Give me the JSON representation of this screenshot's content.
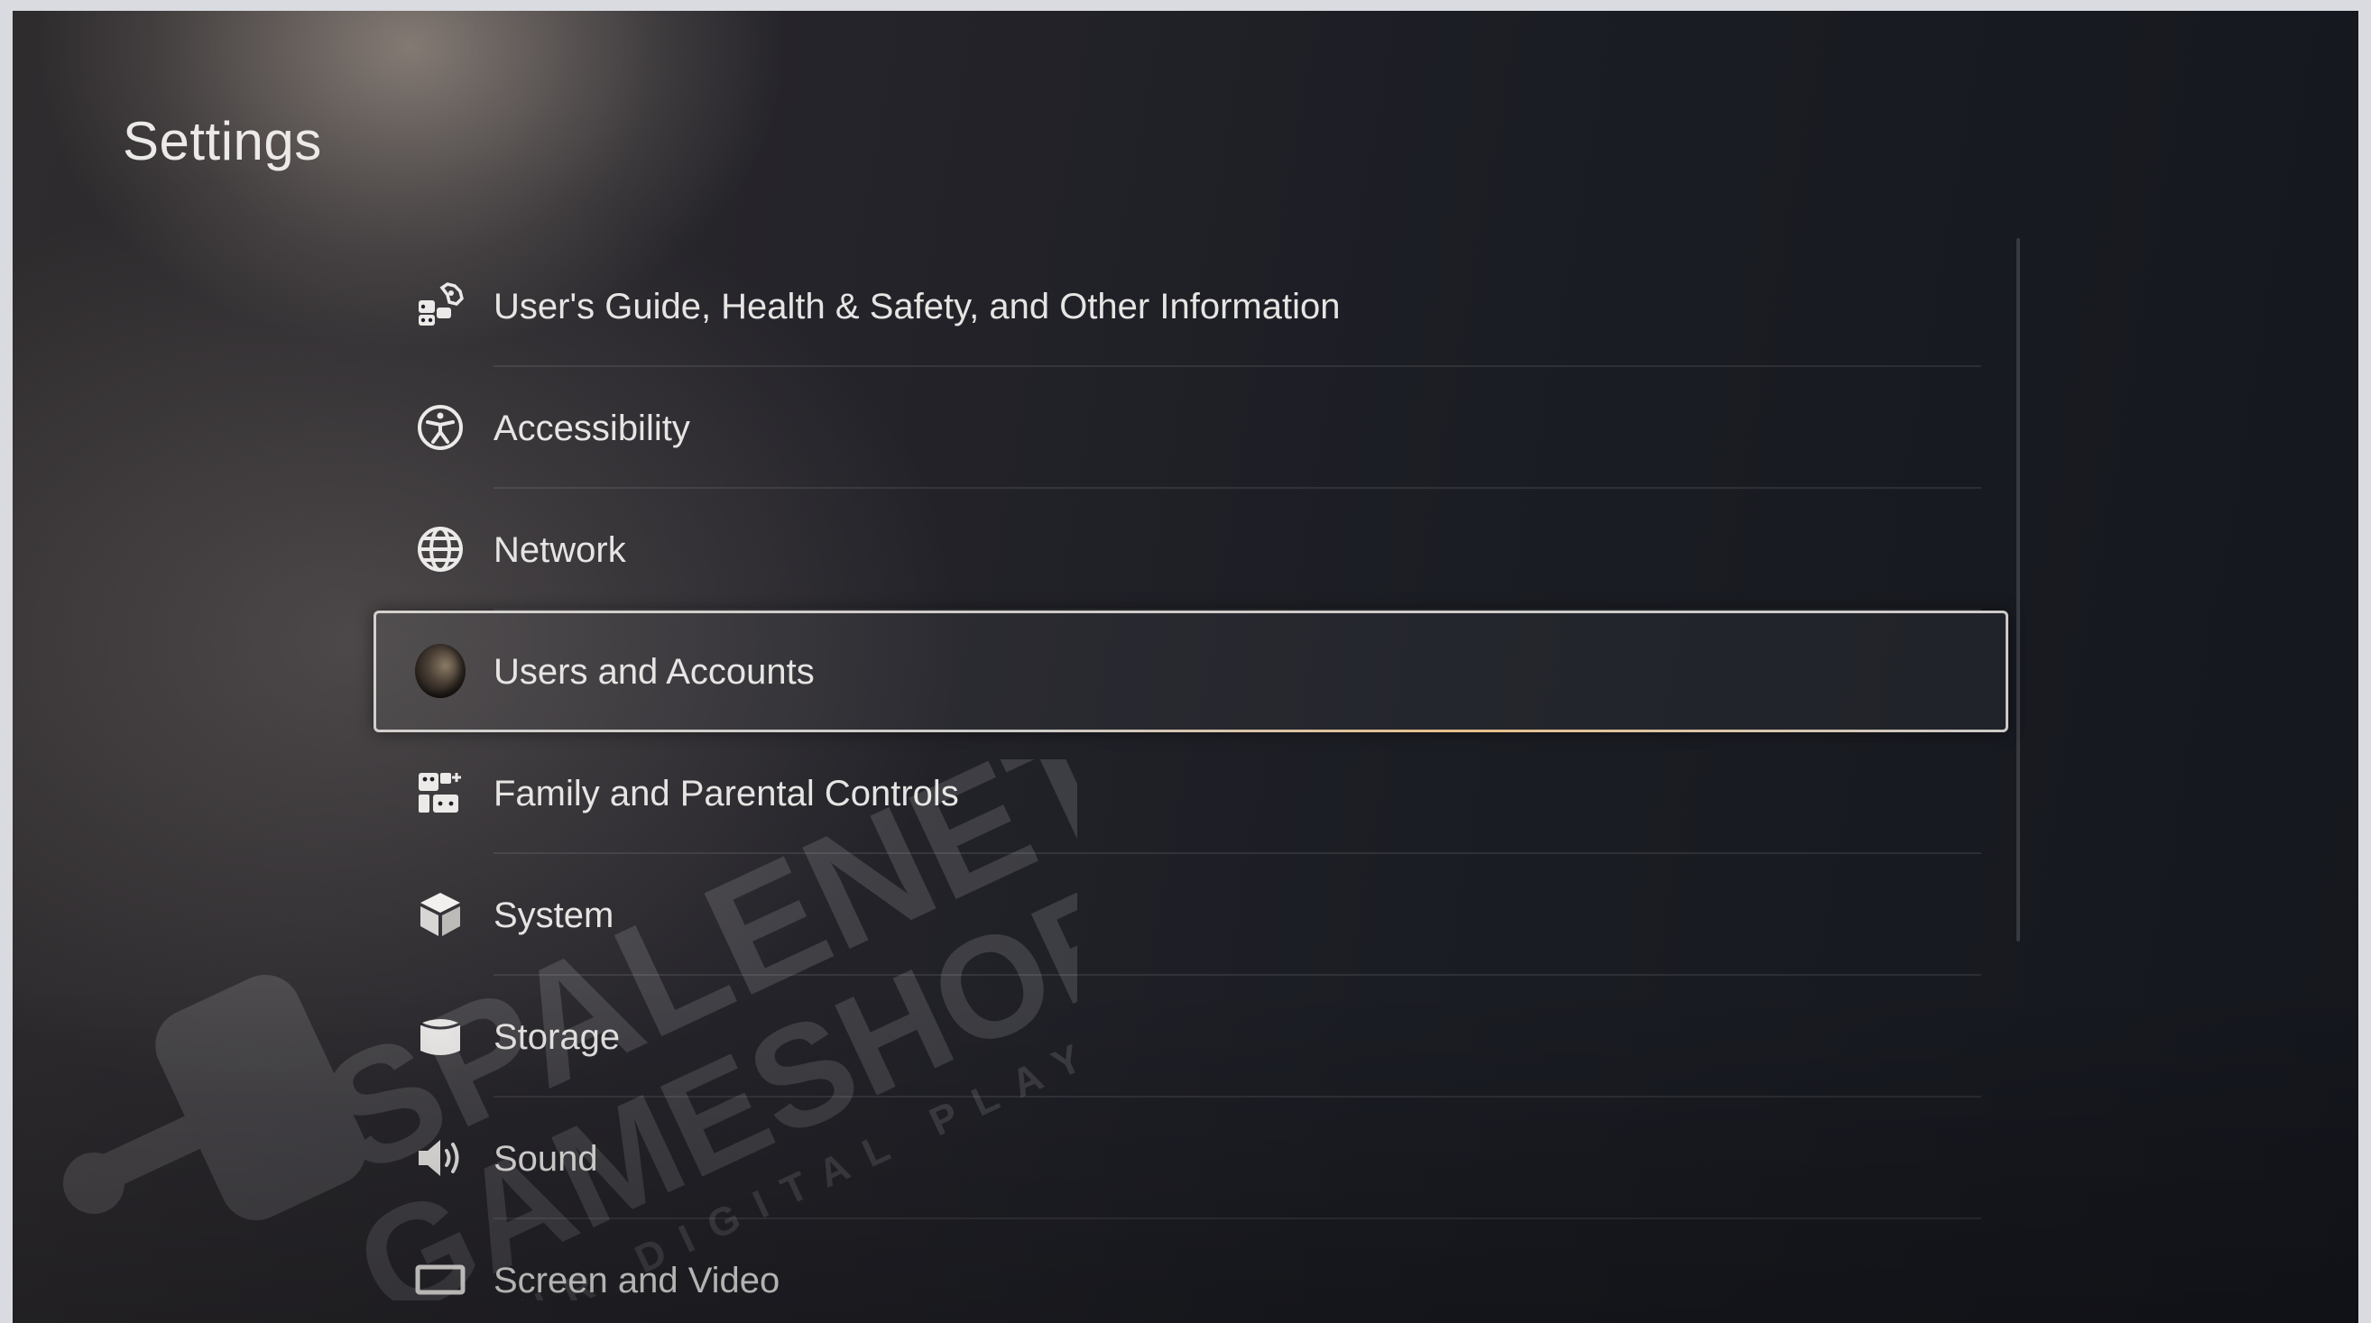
{
  "screen": {
    "title": "Settings"
  },
  "menu": {
    "selected_index": 3,
    "items": [
      {
        "label": "User's Guide, Health & Safety, and Other Information",
        "icon": "guide-icon"
      },
      {
        "label": "Accessibility",
        "icon": "accessibility-icon"
      },
      {
        "label": "Network",
        "icon": "globe-icon"
      },
      {
        "label": "Users and Accounts",
        "icon": "user-avatar-icon"
      },
      {
        "label": "Family and Parental Controls",
        "icon": "family-icon"
      },
      {
        "label": "System",
        "icon": "cube-icon"
      },
      {
        "label": "Storage",
        "icon": "storage-icon"
      },
      {
        "label": "Sound",
        "icon": "speaker-icon"
      },
      {
        "label": "Screen and Video",
        "icon": "screen-icon"
      }
    ]
  },
  "watermark": {
    "line1": "SPALENET",
    "line2": "GAMESHOP",
    "tagline": "YOUR DIGITAL PLAYGROUND"
  },
  "colors": {
    "text": "#e6e5e3",
    "selection_accent": "#e7c08a",
    "background": "#1b1d24"
  }
}
